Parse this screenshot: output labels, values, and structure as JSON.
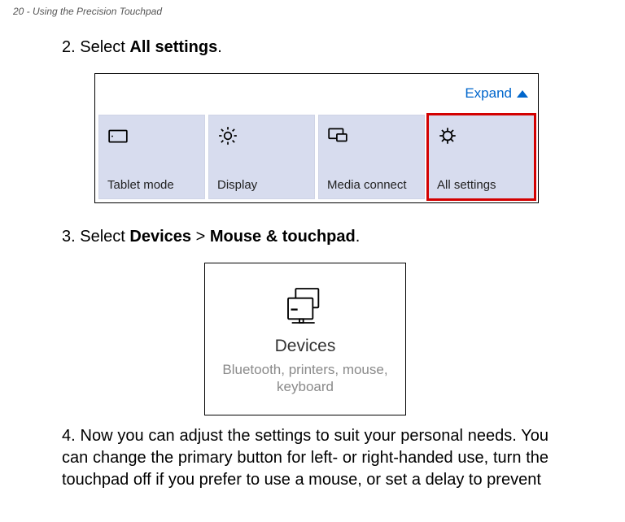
{
  "header": "20 - Using the Precision Touchpad",
  "step2": {
    "num": "2.",
    "prefix": "Select ",
    "bold": "All settings",
    "suffix": "."
  },
  "fig1": {
    "expand": "Expand",
    "tiles": [
      {
        "id": "tablet-mode",
        "label": "Tablet mode"
      },
      {
        "id": "display",
        "label": "Display"
      },
      {
        "id": "media-connect",
        "label": "Media connect"
      },
      {
        "id": "all-settings",
        "label": "All settings"
      }
    ]
  },
  "step3": {
    "num": "3.",
    "prefix": "Select ",
    "bold1": "Devices",
    "sep": " > ",
    "bold2": "Mouse & touchpad",
    "suffix": "."
  },
  "fig2": {
    "title": "Devices",
    "subtitle": "Bluetooth, printers, mouse, keyboard"
  },
  "step4": {
    "num": "4.",
    "text": "Now you can adjust the settings to suit your personal needs. You can change the primary button for left- or right-handed use, turn the touchpad off if you prefer to use a mouse, or set a delay to prevent"
  }
}
